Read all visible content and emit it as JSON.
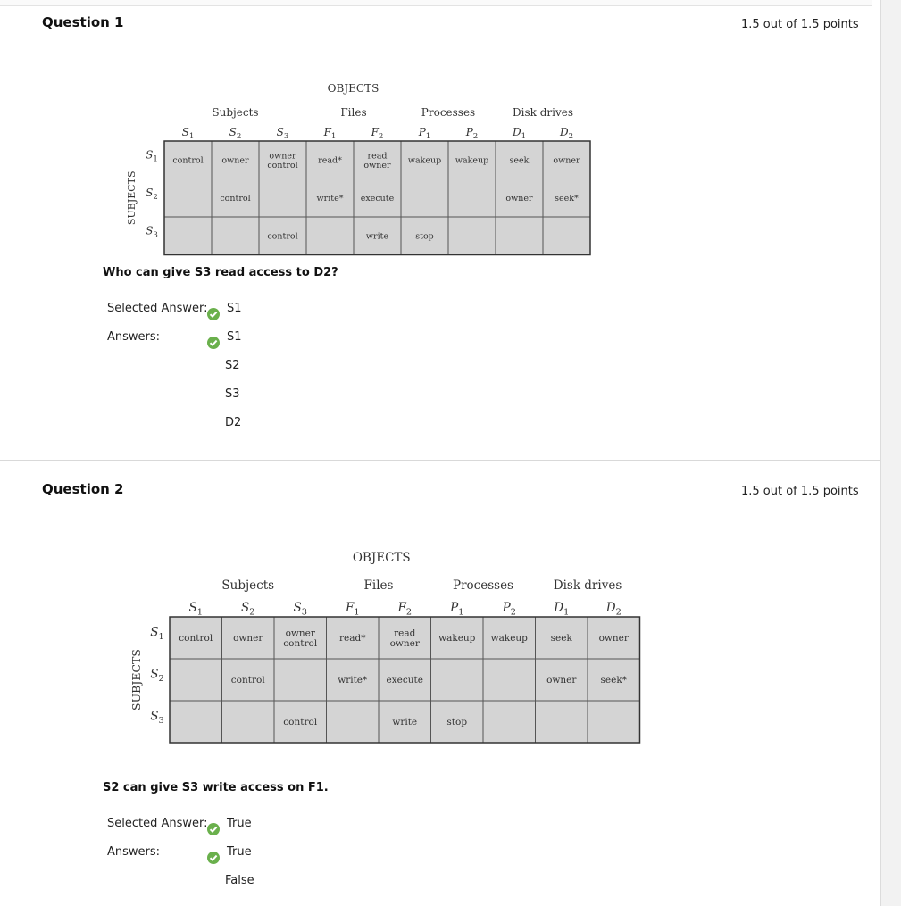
{
  "questions": [
    {
      "title": "Question 1",
      "points": "1.5 out of 1.5 points",
      "prompt": "Who can give S3 read access to D2?",
      "selected_label": "Selected Answer:",
      "selected": "S1",
      "answers_label": "Answers:",
      "answers": [
        "S1",
        "S2",
        "S3",
        "D2"
      ],
      "correct_index": 0
    },
    {
      "title": "Question 2",
      "points": "1.5 out of 1.5 points",
      "prompt": "S2 can give S3 write access on F1.",
      "selected_label": "Selected Answer:",
      "selected": "True",
      "answers_label": "Answers:",
      "answers": [
        "True",
        "False"
      ],
      "correct_index": 0
    }
  ],
  "matrix": {
    "objects_label": "OBJECTS",
    "subjects_axis_label": "SUBJECTS",
    "groups": [
      "Subjects",
      "Files",
      "Processes",
      "Disk drives"
    ],
    "columns": [
      "S1",
      "S2",
      "S3",
      "F1",
      "F2",
      "P1",
      "P2",
      "D1",
      "D2"
    ],
    "rows": [
      "S1",
      "S2",
      "S3"
    ],
    "cells": [
      [
        "control",
        "owner",
        "owner\ncontrol",
        "read*",
        "read\nowner",
        "wakeup",
        "wakeup",
        "seek",
        "owner"
      ],
      [
        "",
        "control",
        "",
        "write*",
        "execute",
        "",
        "",
        "owner",
        "seek*"
      ],
      [
        "",
        "",
        "control",
        "",
        "write",
        "stop",
        "",
        "",
        ""
      ]
    ],
    "cell_color": "#d4d4d4",
    "check_color": "#6ab04c"
  }
}
